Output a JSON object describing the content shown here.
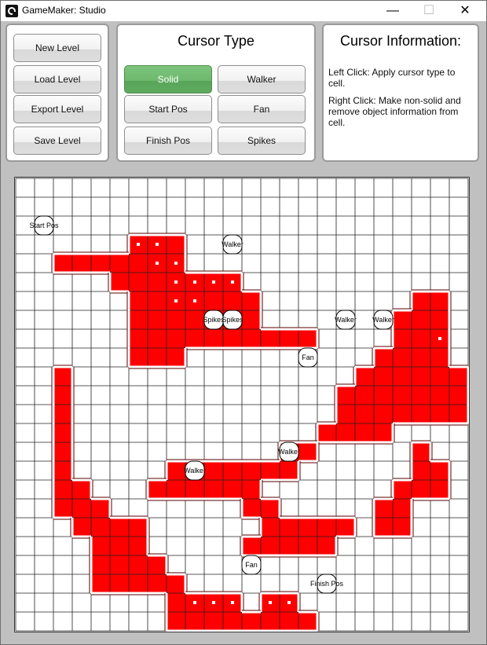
{
  "window": {
    "title": "GameMaker: Studio",
    "controls": {
      "minimize": "—",
      "maximize": "☐",
      "close": "✕"
    },
    "icon": "gamemaker-icon"
  },
  "file_panel": {
    "buttons": [
      "New Level",
      "Load Level",
      "Export Level",
      "Save Level"
    ]
  },
  "cursor_panel": {
    "title": "Cursor Type",
    "buttons": [
      "Solid",
      "Walker",
      "Start Pos",
      "Fan",
      "Finish Pos",
      "Spikes"
    ],
    "selected": "Solid",
    "selected_color": "#6db96d"
  },
  "info_panel": {
    "title": "Cursor Information:",
    "lines": [
      "Left Click: Apply cursor type to cell.",
      "Right Click: Make non-solid and remove object information from cell."
    ]
  },
  "grid": {
    "cols": 24,
    "rows": 24,
    "solid_color": "#ff0000",
    "solid_rows": [
      "........................",
      "........................",
      "....................... .",
      "......###...............",
      "..#######...............",
      ".....#######............",
      "......#######........##.",
      "......#######.......###.",
      "......##########....###.",
      "......###..........####.",
      "..#...............######",
      "..#..............#######",
      "..#..............#######",
      "..#.............####....",
      "..#...........##.....#..",
      "..#.....#######......##.",
      "..##...######.......###.",
      "..###.......##.....##...",
      "...####......#####.##...",
      "....###.....#####.......",
      "....####................",
      "....#####...............",
      "........####.##.........",
      "........########........"
    ],
    "dots": [
      [
        6,
        3
      ],
      [
        7,
        3
      ],
      [
        7,
        4
      ],
      [
        8,
        4
      ],
      [
        9,
        4
      ],
      [
        10,
        4
      ],
      [
        8,
        5
      ],
      [
        9,
        5
      ],
      [
        10,
        5
      ],
      [
        11,
        5
      ],
      [
        12,
        5
      ],
      [
        8,
        6
      ],
      [
        9,
        6
      ],
      [
        22,
        8
      ],
      [
        13,
        11
      ],
      [
        14,
        11
      ],
      [
        1,
        13
      ],
      [
        6,
        17
      ],
      [
        13,
        20
      ],
      [
        9,
        22
      ],
      [
        10,
        22
      ],
      [
        11,
        22
      ],
      [
        12,
        22
      ],
      [
        13,
        22
      ],
      [
        14,
        22
      ]
    ],
    "objects": [
      {
        "label": "Start Pos",
        "col": 1,
        "row": 2
      },
      {
        "label": "Walker",
        "col": 11,
        "row": 3
      },
      {
        "label": "Spikes",
        "col": 10,
        "row": 7
      },
      {
        "label": "Spikes",
        "col": 11,
        "row": 7
      },
      {
        "label": "Walker",
        "col": 17,
        "row": 7
      },
      {
        "label": "Walker",
        "col": 19,
        "row": 7
      },
      {
        "label": "Fan",
        "col": 15,
        "row": 9
      },
      {
        "label": "Walker",
        "col": 14,
        "row": 14
      },
      {
        "label": "Walker",
        "col": 9,
        "row": 15
      },
      {
        "label": "Fan",
        "col": 12,
        "row": 20
      },
      {
        "label": "Finish Pos",
        "col": 16,
        "row": 21
      }
    ]
  }
}
